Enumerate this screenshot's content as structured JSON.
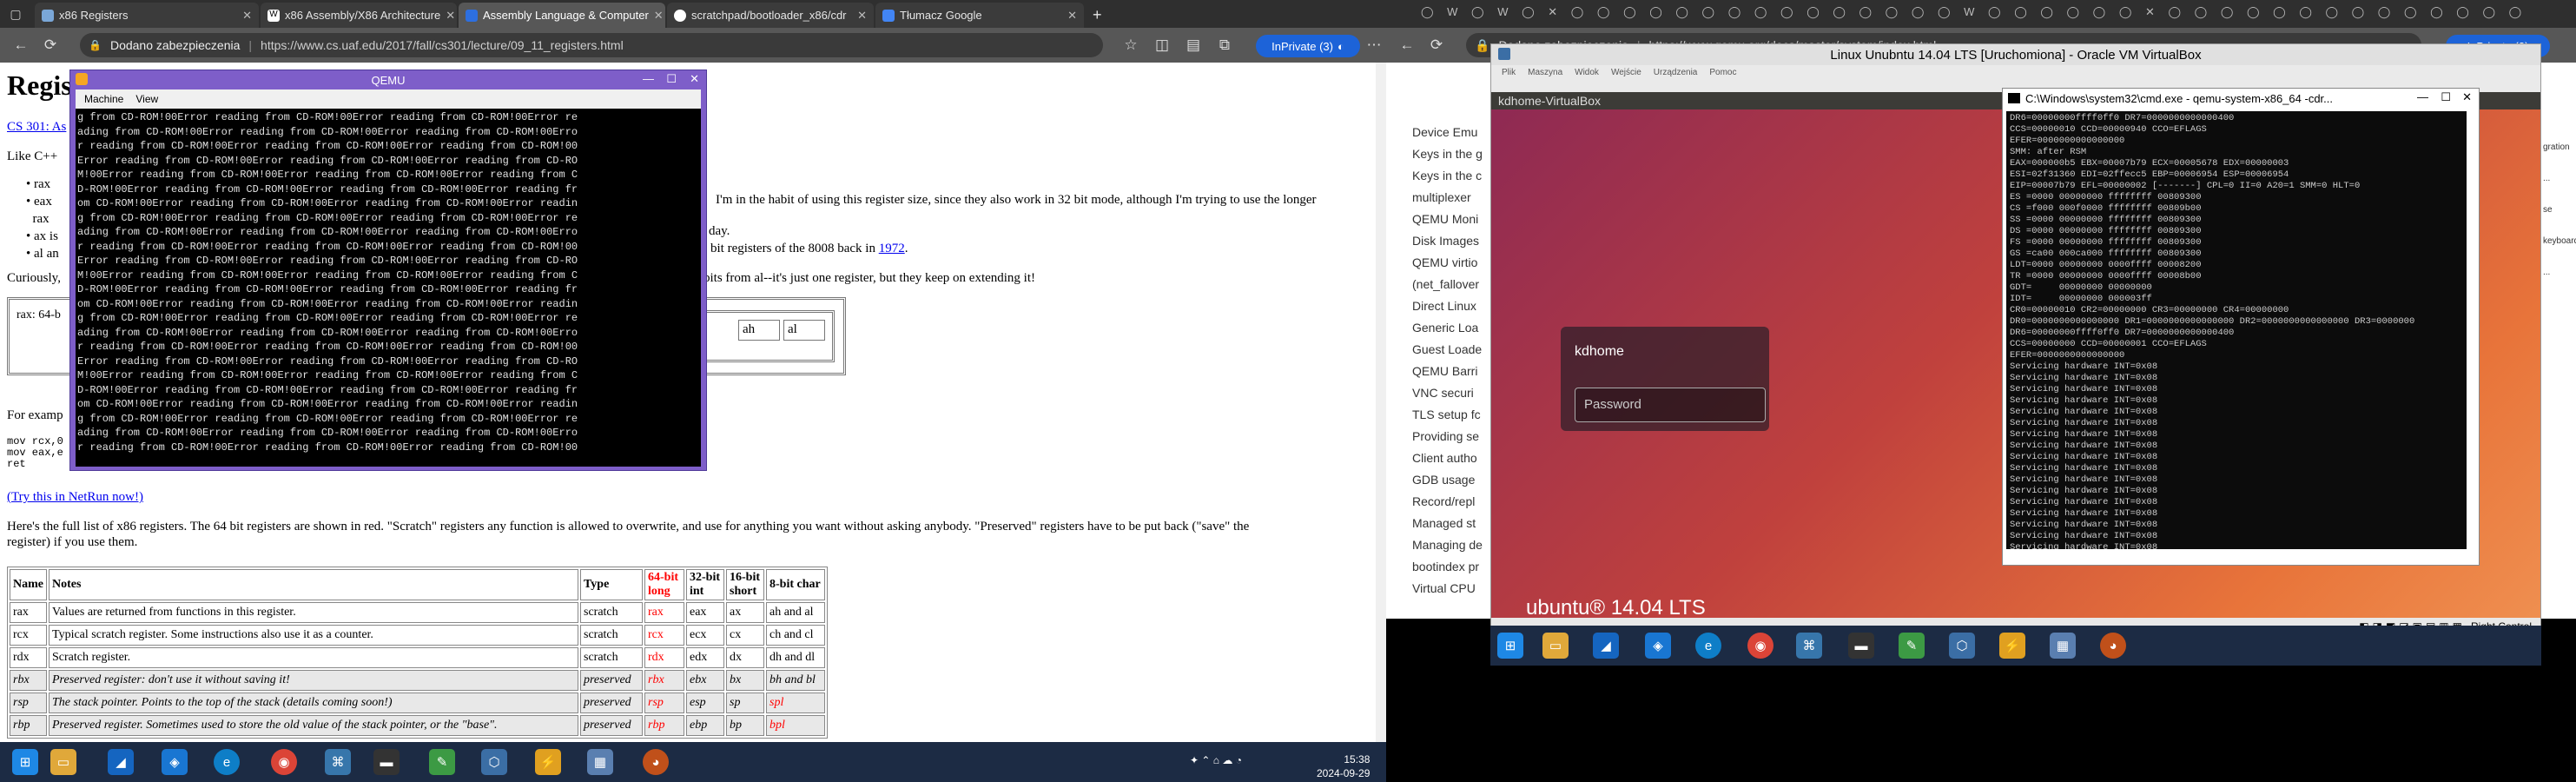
{
  "left_browser": {
    "tabs": [
      {
        "label": "x86 Registers",
        "fav_color": "#7aa7d8"
      },
      {
        "label": "x86 Assembly/X86 Architecture",
        "fav_color": "#ffffff"
      },
      {
        "label": "Assembly Language & Computer",
        "fav_color": "#2d6fe0"
      },
      {
        "label": "scratchpad/bootloader_x86/cdr",
        "fav_color": "#ffffff"
      },
      {
        "label": "Tłumacz Google",
        "fav_color": "#4285f4"
      }
    ],
    "new_tab": "+",
    "security_label": "Dodano zabezpieczenia",
    "url": "https://www.cs.uaf.edu/2017/fall/cs301/lecture/09_11_registers.html",
    "inprivate": "InPrivate (3)",
    "page": {
      "title": "Regis",
      "course_link": "CS 301: As",
      "like_cpp": "Like C++",
      "bullets_text": "I'm in the habit of using this register size, since they also work in 32 bit mode, although I'm trying to use the longer",
      "day": "day.",
      "bit_regs": "bit registers of the 8008 back in",
      "year_link": "1972",
      "curiously": "Curiously,",
      "bits_from": "bits from al--it's just one register, but they keep on extending it!",
      "rax_label": "rax: 64-b",
      "ah": "ah",
      "al": "al",
      "for_example": "For examp",
      "code_lines": [
        "mov rcx,0",
        "mov eax,e",
        "ret"
      ],
      "try_link": "(Try this in NetRun now!)",
      "desc_line1": "Here's the full list of x86 registers.  The 64 bit registers are shown in red.  \"Scratch\" registers any function is allowed to overwrite, and use for anything you want without asking anybody.  \"Preserved\" registers have to be put back (\"save\" the",
      "desc_line2": "register) if you use them.",
      "table_headers": [
        "Name",
        "Notes",
        "Type",
        "64-bit long",
        "32-bit int",
        "16-bit short",
        "8-bit char"
      ],
      "table_rows": [
        {
          "name": "rax",
          "notes": "Values are returned from functions in this register.",
          "type": "scratch",
          "b64": "rax",
          "b32": "eax",
          "b16": "ax",
          "b8": "ah and al",
          "preserved": false
        },
        {
          "name": "rcx",
          "notes": "Typical scratch register.  Some instructions also use it as a counter.",
          "type": "scratch",
          "b64": "rcx",
          "b32": "ecx",
          "b16": "cx",
          "b8": "ch and cl",
          "preserved": false
        },
        {
          "name": "rdx",
          "notes": "Scratch register.",
          "type": "scratch",
          "b64": "rdx",
          "b32": "edx",
          "b16": "dx",
          "b8": "dh and dl",
          "preserved": false
        },
        {
          "name": "rbx",
          "notes": "Preserved register: don't use it without saving it!",
          "type": "preserved",
          "b64": "rbx",
          "b32": "ebx",
          "b16": "bx",
          "b8": "bh and bl",
          "preserved": true
        },
        {
          "name": "rsp",
          "notes": "The stack pointer.  Points to the top of the stack (details coming soon!)",
          "type": "preserved",
          "b64": "rsp",
          "b32": "esp",
          "b16": "sp",
          "b8": "spl",
          "preserved": true
        },
        {
          "name": "rbp",
          "notes": "Preserved register.  Sometimes used to store the old value of the stack pointer, or the \"base\".",
          "type": "preserved",
          "b64": "rbp",
          "b32": "ebp",
          "b16": "bp",
          "b8": "bpl",
          "preserved": true
        }
      ]
    },
    "qemu": {
      "title": "QEMU",
      "menu": [
        "Machine",
        "View"
      ],
      "error_line_a": "g from CD-ROM!00Error reading from CD-ROM!00Error reading from CD-ROM!00Error re",
      "error_line_b": "ading from CD-ROM!00Error reading from CD-ROM!00Error reading from CD-ROM!00Erro",
      "error_line_c": "r reading from CD-ROM!00Error reading from CD-ROM!00Error reading from CD-ROM!00",
      "error_line_d": "Error reading from CD-ROM!00Error reading from CD-ROM!00Error reading from CD-RO",
      "error_line_e": "M!00Error reading from CD-ROM!00Error reading from CD-ROM!00Error reading from C",
      "error_line_f": "D-ROM!00Error reading from CD-ROM!00Error reading from CD-ROM!00Error reading fr",
      "error_line_g": "om CD-ROM!00Error reading from CD-ROM!00Error reading from CD-ROM!00Error readin"
    },
    "taskbar": {
      "time": "15:38",
      "date": "2024-09-29"
    }
  },
  "right_desktop": {
    "security_label": "Dodano zabezpieczenia",
    "url": "https://www.qemu.org/docs/master/system/index.html",
    "inprivate": "InPrivate (3)",
    "sidebar_items": [
      "Device Emu",
      "Keys in the g",
      "Keys in the c",
      "multiplexer",
      "QEMU Moni",
      "Disk Images",
      "QEMU virtio",
      "(net_fallover",
      "Direct Linux",
      "Generic Loa",
      "Guest Loade",
      "QEMU Barri",
      "VNC securi",
      "TLS setup fc",
      "Providing se",
      "Client autho",
      "GDB usage",
      "Record/repl",
      "Managed st",
      "Managing de",
      "bootindex pr",
      "Virtual CPU"
    ],
    "right_snippets": [
      "gration ...",
      "se keyboard ..."
    ],
    "virtualbox": {
      "title": "Linux Unubntu 14.04 LTS [Uruchomiona] - Oracle VM VirtualBox",
      "menu": [
        "Plik",
        "Maszyna",
        "Widok",
        "Wejście",
        "Urządzenia",
        "Pomoc"
      ],
      "ubuntu_top": "kdhome-VirtualBox",
      "login_user": "kdhome",
      "password_placeholder": "Password",
      "ubuntu_logo": "ubuntu® 14.04 LTS",
      "status": "Right Control"
    },
    "cmd": {
      "title": "C:\\Windows\\system32\\cmd.exe - qemu-system-x86_64 -cdr...",
      "lines": [
        "DR6=00000000ffff0ff0 DR7=0000000000000400",
        "CCS=00000010 CCD=00000940 CCO=EFLAGS",
        "EFER=0000000000000000",
        "SMM: after RSM",
        "EAX=000000b5 EBX=00007b79 ECX=00005678 EDX=00000003",
        "ESI=02f31360 EDI=02ffecc5 EBP=00006954 ESP=00006954",
        "EIP=00007b79 EFL=00000002 [-------] CPL=0 II=0 A20=1 SMM=0 HLT=0",
        "ES =0000 00000000 ffffffff 00809300",
        "CS =f000 000f0000 ffffffff 00809b00",
        "SS =0000 00000000 ffffffff 00809300",
        "DS =0000 00000000 ffffffff 00809300",
        "FS =0000 00000000 ffffffff 00809300",
        "GS =ca00 000ca000 ffffffff 00809300",
        "LDT=0000 00000000 0000ffff 00008200",
        "TR =0000 00000000 0000ffff 00008b00",
        "GDT=     00000000 00000000",
        "IDT=     00000000 000003ff",
        "CR0=00000010 CR2=00000000 CR3=00000000 CR4=00000000",
        "DR0=0000000000000000 DR1=0000000000000000 DR2=0000000000000000 DR3=0000000",
        "DR6=00000000ffff0ff0 DR7=0000000000000400",
        "CCS=00000000 CCD=00000001 CCO=EFLAGS",
        "EFER=0000000000000000",
        "Servicing hardware INT=0x08",
        "Servicing hardware INT=0x08",
        "Servicing hardware INT=0x08",
        "Servicing hardware INT=0x08",
        "Servicing hardware INT=0x08",
        "Servicing hardware INT=0x08",
        "Servicing hardware INT=0x08",
        "Servicing hardware INT=0x08",
        "Servicing hardware INT=0x08",
        "Servicing hardware INT=0x08",
        "Servicing hardware INT=0x08",
        "Servicing hardware INT=0x08",
        "Servicing hardware INT=0x08",
        "Servicing hardware INT=0x08",
        "Servicing hardware INT=0x08",
        "Servicing hardware INT=0x08",
        "Servicing hardware INT=0x08",
        "Servicing hardware INT=0x08"
      ]
    }
  }
}
